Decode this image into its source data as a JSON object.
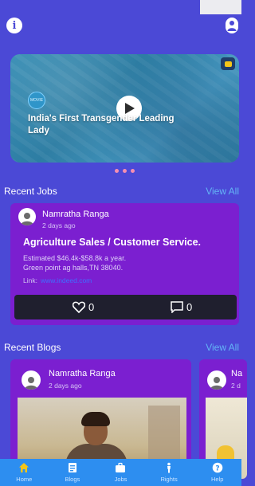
{
  "header": {
    "info_icon_glyph": "i"
  },
  "carousel": {
    "title": "India's First Transgender Leading Lady",
    "logo_text": "MOVIE"
  },
  "recent_jobs": {
    "title": "Recent Jobs",
    "view_all": "View All",
    "card": {
      "author": "Namratha Ranga",
      "time": "2 days ago",
      "job_title": "Agriculture Sales / Customer Service.",
      "salary": "Estimated $46.4k-$58.8k a year.",
      "location": "Green point ag halls,TN 38040.",
      "link_label": "Link:",
      "link_url": "www.indeed.com",
      "likes": "0",
      "comments": "0"
    }
  },
  "recent_blogs": {
    "title": "Recent Blogs",
    "view_all": "View All",
    "cards": [
      {
        "author": "Namratha Ranga",
        "time": "2 days ago"
      },
      {
        "author": "Na",
        "time": "2 d"
      }
    ]
  },
  "bottom_nav": [
    {
      "label": "Home",
      "icon": "home-icon",
      "active": true
    },
    {
      "label": "Blogs",
      "icon": "blog-icon",
      "active": false
    },
    {
      "label": "Jobs",
      "icon": "briefcase-icon",
      "active": false
    },
    {
      "label": "Rights",
      "icon": "person-icon",
      "active": false
    },
    {
      "label": "Help",
      "icon": "help-icon",
      "active": false
    }
  ],
  "colors": {
    "background": "#4b49d6",
    "card": "#7b1fd0",
    "accent_link": "#64b5f6",
    "nav_bar": "#2d8ef0",
    "nav_active": "#f5c518"
  }
}
